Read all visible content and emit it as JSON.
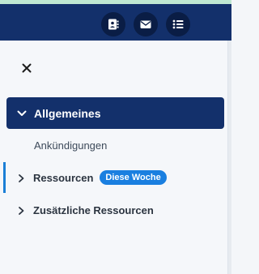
{
  "header": {
    "buttons": [
      {
        "icon": "contact-book-icon"
      },
      {
        "icon": "mail-icon"
      },
      {
        "icon": "list-icon"
      }
    ]
  },
  "panel": {
    "close_icon": "close-icon",
    "nav": [
      {
        "label": "Allgemeines",
        "expanded": true,
        "active": true,
        "children": [
          {
            "label": "Ankündigungen"
          }
        ]
      },
      {
        "label": "Ressourcen",
        "expanded": false,
        "badge": "Diese Woche"
      },
      {
        "label": "Zusätzliche Ressourcen",
        "expanded": false
      }
    ]
  },
  "colors": {
    "header_bg": "#13306b",
    "active_bg": "#13306b",
    "badge_bg": "#1a7fe0",
    "indicator": "#1b7fd6"
  }
}
